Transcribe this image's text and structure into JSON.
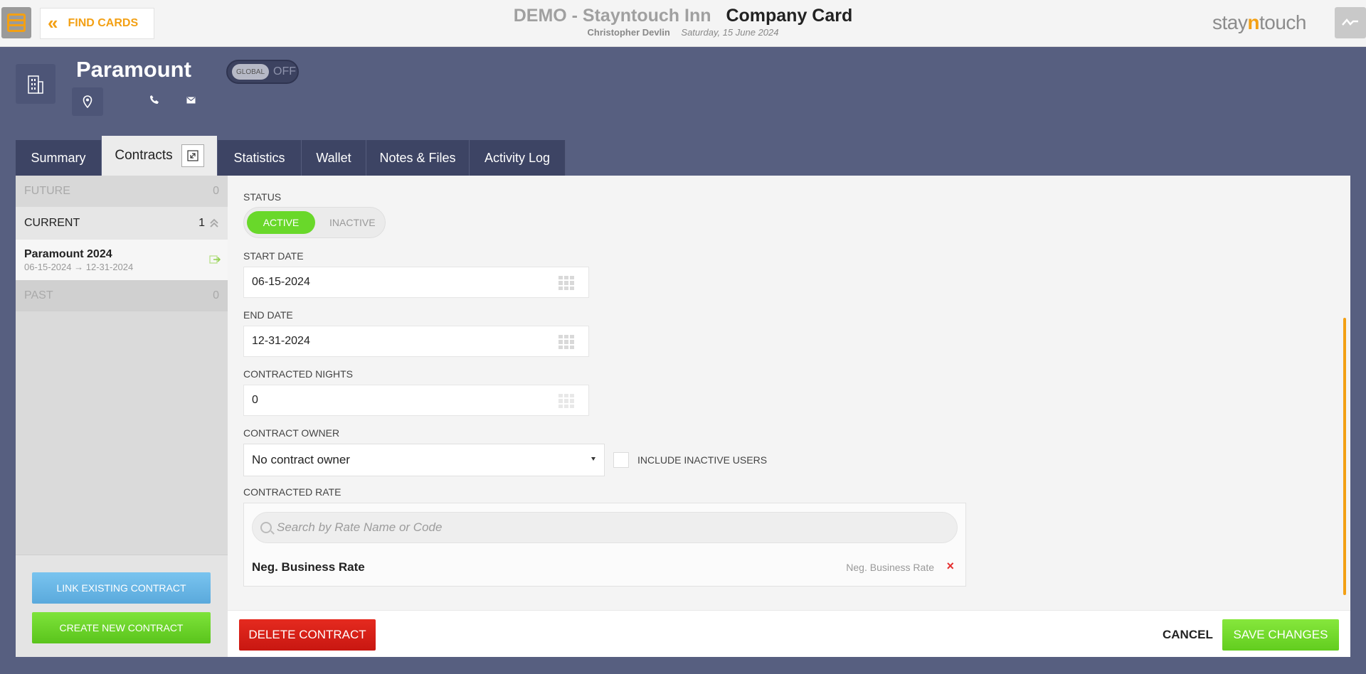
{
  "topbar": {
    "menu_icon": "menu-icon",
    "find_cards_label": "FIND CARDS",
    "hotel_name": "DEMO - Stayntouch Inn",
    "page_title": "Company Card",
    "user_name": "Christopher Devlin",
    "business_date": "Saturday, 15 June 2024",
    "brand_prefix": "stay",
    "brand_accent": "n",
    "brand_suffix": "touch",
    "activity_icon": "activity-icon"
  },
  "card": {
    "name": "Paramount",
    "global_label": "GLOBAL",
    "global_state": "OFF",
    "icons": [
      "building-icon",
      "location-pin-icon",
      "phone-icon",
      "mail-icon"
    ]
  },
  "tabs": [
    {
      "label": "Summary"
    },
    {
      "label": "Contracts"
    },
    {
      "label": "Statistics"
    },
    {
      "label": "Wallet"
    },
    {
      "label": "Notes & Files"
    },
    {
      "label": "Activity Log"
    }
  ],
  "sidebar": {
    "future": {
      "label": "FUTURE",
      "count": "0"
    },
    "current": {
      "label": "CURRENT",
      "count": "1"
    },
    "contract": {
      "name": "Paramount 2024",
      "start": "06-15-2024",
      "end": "12-31-2024"
    },
    "past": {
      "label": "PAST",
      "count": "0"
    },
    "link_label": "LINK EXISTING CONTRACT",
    "create_label": "CREATE NEW CONTRACT"
  },
  "form": {
    "status_label": "STATUS",
    "status_active": "ACTIVE",
    "status_inactive": "INACTIVE",
    "start_date_label": "START DATE",
    "start_date": "06-15-2024",
    "end_date_label": "END DATE",
    "end_date": "12-31-2024",
    "nights_label": "CONTRACTED NIGHTS",
    "nights": "0",
    "owner_label": "CONTRACT OWNER",
    "owner_value": "No contract owner",
    "include_inactive_label": "INCLUDE INACTIVE USERS",
    "rate_label": "CONTRACTED RATE",
    "rate_search_placeholder": "Search by Rate Name or Code",
    "rate_name": "Neg. Business Rate",
    "rate_code": "Neg. Business Rate",
    "rate_remove": "×"
  },
  "footer": {
    "delete_label": "DELETE CONTRACT",
    "cancel_label": "CANCEL",
    "save_label": "SAVE CHANGES"
  },
  "colors": {
    "accent": "#f3a014",
    "background": "#575f80",
    "active_green": "#69d82a",
    "delete_red": "#d41f16",
    "link_blue": "#6bb7e6"
  }
}
